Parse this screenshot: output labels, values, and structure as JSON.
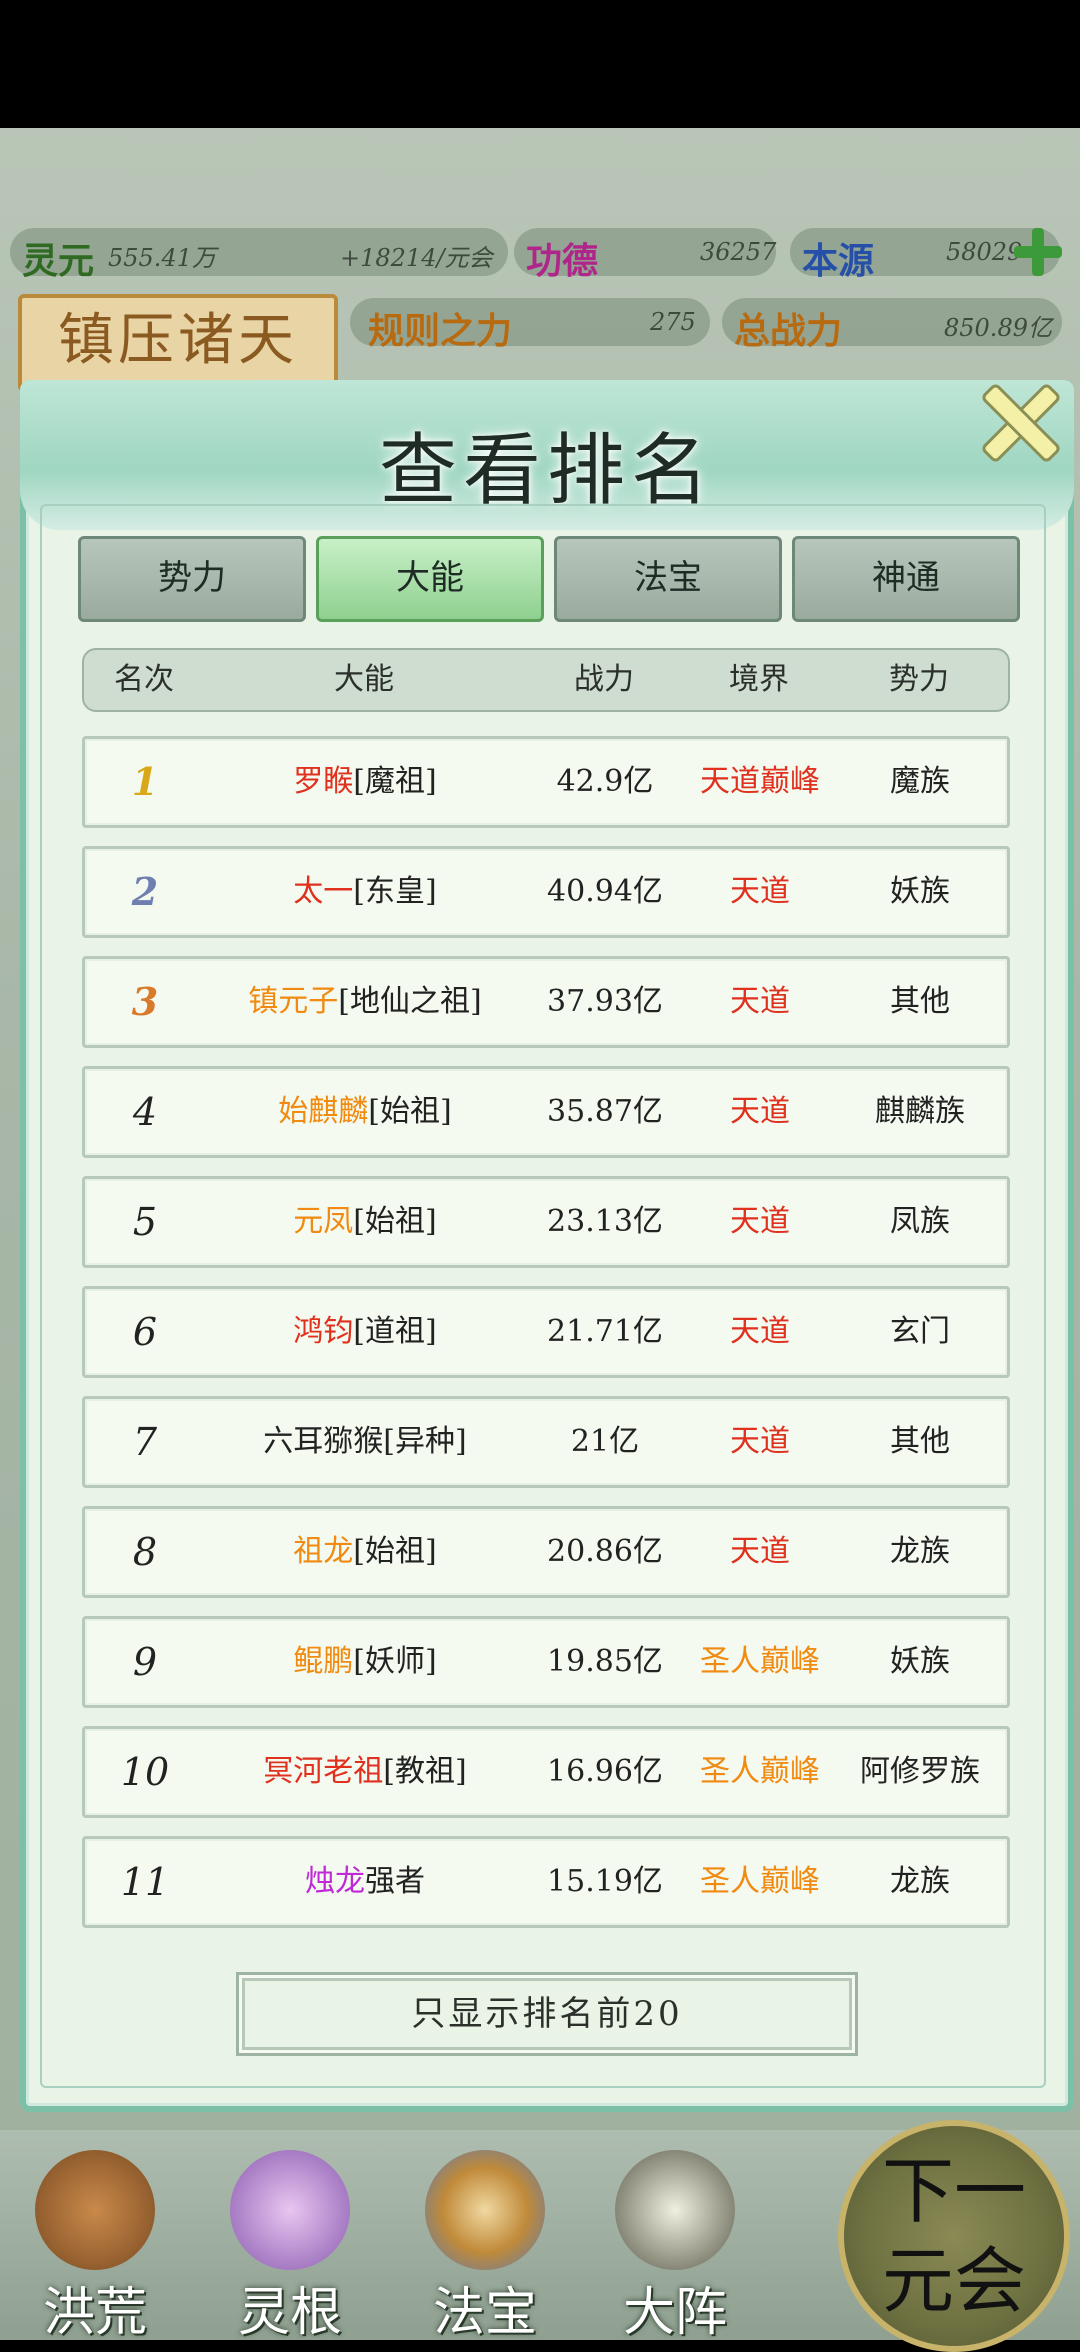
{
  "resources": {
    "lingyuan": {
      "label": "灵元",
      "value": "555.41万",
      "rate": "+18214/元会"
    },
    "gongde": {
      "label": "功德",
      "value": "36257"
    },
    "benyuan": {
      "label": "本源",
      "value": "58029"
    },
    "guize": {
      "label": "规则之力",
      "value": "275"
    },
    "zhanli": {
      "label": "总战力",
      "value": "850.89亿"
    }
  },
  "banner": "镇压诸天",
  "dialog": {
    "title": "查看排名",
    "tabs": [
      "势力",
      "大能",
      "法宝",
      "神通"
    ],
    "active_tab": "大能",
    "headers": {
      "rank": "名次",
      "name": "大能",
      "power": "战力",
      "realm": "境界",
      "faction": "势力"
    },
    "rows": [
      {
        "rank": "1",
        "name": "罗睺",
        "title": "[魔祖]",
        "power": "42.9亿",
        "realm": "天道巅峰",
        "faction": "魔族",
        "name_color": "#e0301e",
        "realm_color": "#e0301e"
      },
      {
        "rank": "2",
        "name": "太一",
        "title": "[东皇]",
        "power": "40.94亿",
        "realm": "天道",
        "faction": "妖族",
        "name_color": "#e0301e",
        "realm_color": "#e0301e"
      },
      {
        "rank": "3",
        "name": "镇元子",
        "title": "[地仙之祖]",
        "power": "37.93亿",
        "realm": "天道",
        "faction": "其他",
        "name_color": "#f08a10",
        "realm_color": "#e0301e"
      },
      {
        "rank": "4",
        "name": "始麒麟",
        "title": "[始祖]",
        "power": "35.87亿",
        "realm": "天道",
        "faction": "麒麟族",
        "name_color": "#f08a10",
        "realm_color": "#e0301e"
      },
      {
        "rank": "5",
        "name": "元凤",
        "title": "[始祖]",
        "power": "23.13亿",
        "realm": "天道",
        "faction": "凤族",
        "name_color": "#f08a10",
        "realm_color": "#e0301e"
      },
      {
        "rank": "6",
        "name": "鸿钧",
        "title": "[道祖]",
        "power": "21.71亿",
        "realm": "天道",
        "faction": "玄门",
        "name_color": "#e0301e",
        "realm_color": "#e0301e"
      },
      {
        "rank": "7",
        "name": "六耳猕猴",
        "title": "[异种]",
        "power": "21亿",
        "realm": "天道",
        "faction": "其他",
        "name_color": "#222222",
        "realm_color": "#e0301e"
      },
      {
        "rank": "8",
        "name": "祖龙",
        "title": "[始祖]",
        "power": "20.86亿",
        "realm": "天道",
        "faction": "龙族",
        "name_color": "#f08a10",
        "realm_color": "#e0301e"
      },
      {
        "rank": "9",
        "name": "鲲鹏",
        "title": "[妖师]",
        "power": "19.85亿",
        "realm": "圣人巅峰",
        "faction": "妖族",
        "name_color": "#f08a10",
        "realm_color": "#f08a10"
      },
      {
        "rank": "10",
        "name": "冥河老祖",
        "title": "[教祖]",
        "power": "16.96亿",
        "realm": "圣人巅峰",
        "faction": "阿修罗族",
        "name_color": "#e0301e",
        "realm_color": "#f08a10"
      },
      {
        "rank": "11",
        "name": "烛龙",
        "title": "强者",
        "power": "15.19亿",
        "realm": "圣人巅峰",
        "faction": "龙族",
        "name_color": "#c028d8",
        "realm_color": "#f08a10"
      }
    ],
    "bottom_button": "只显示排名前20"
  },
  "nav": [
    "洪荒",
    "灵根",
    "法宝",
    "大阵"
  ],
  "next_button": [
    "下一",
    "元会"
  ]
}
